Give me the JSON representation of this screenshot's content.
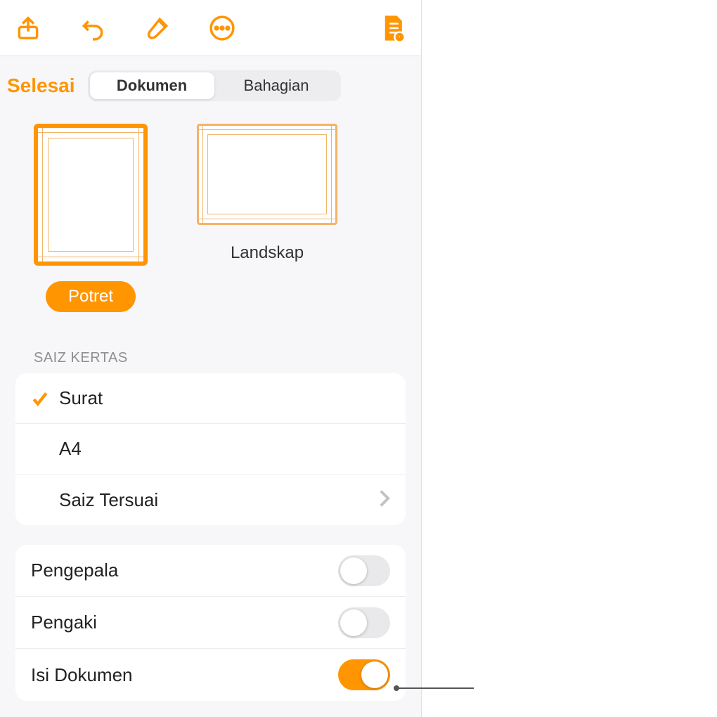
{
  "header": {
    "done_label": "Selesai",
    "segmented": {
      "document": "Dokumen",
      "section": "Bahagian"
    }
  },
  "orientation": {
    "portrait_label": "Potret",
    "landscape_label": "Landskap"
  },
  "paper_size": {
    "title": "SAIZ KERTAS",
    "options": {
      "letter": "Surat",
      "a4": "A4",
      "custom": "Saiz Tersuai"
    }
  },
  "toggles": {
    "header": "Pengepala",
    "footer": "Pengaki",
    "body": "Isi Dokumen"
  },
  "colors": {
    "accent": "#ff9500"
  }
}
